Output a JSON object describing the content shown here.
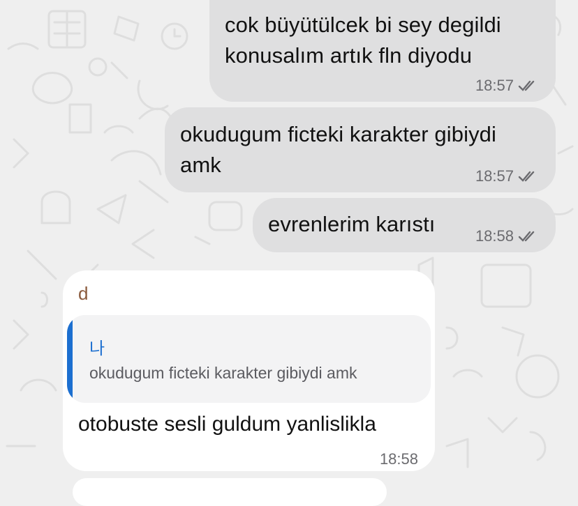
{
  "chat": {
    "messages": [
      {
        "id": "m1",
        "direction": "outgoing",
        "text_lines": [
          "cok büyütülcek bi sey degildi",
          "konusalım artık fln diyodu"
        ],
        "time": "18:57",
        "status": "read"
      },
      {
        "id": "m2",
        "direction": "outgoing",
        "text_lines": [
          "okudugum ficteki karakter gibiydi",
          "amk"
        ],
        "time": "18:57",
        "status": "read"
      },
      {
        "id": "m3",
        "direction": "outgoing",
        "text_lines": [
          "evrenlerim karıstı"
        ],
        "time": "18:58",
        "status": "read"
      },
      {
        "id": "m4",
        "direction": "incoming",
        "sender": "d",
        "reply": {
          "name": "나",
          "text": "okudugum ficteki karakter gibiydi amk"
        },
        "text": "otobuste sesli guldum yanlislikla",
        "time": "18:58"
      }
    ]
  },
  "colors": {
    "chat_background": "#efefef",
    "outgoing_bubble": "#dfdfe0",
    "incoming_bubble": "#ffffff",
    "reply_accent": "#1c6fd0",
    "sender_name": "#8a5a3c",
    "meta_text": "#6b6b6f"
  },
  "icons": {
    "read_receipt": "double-check-icon"
  }
}
